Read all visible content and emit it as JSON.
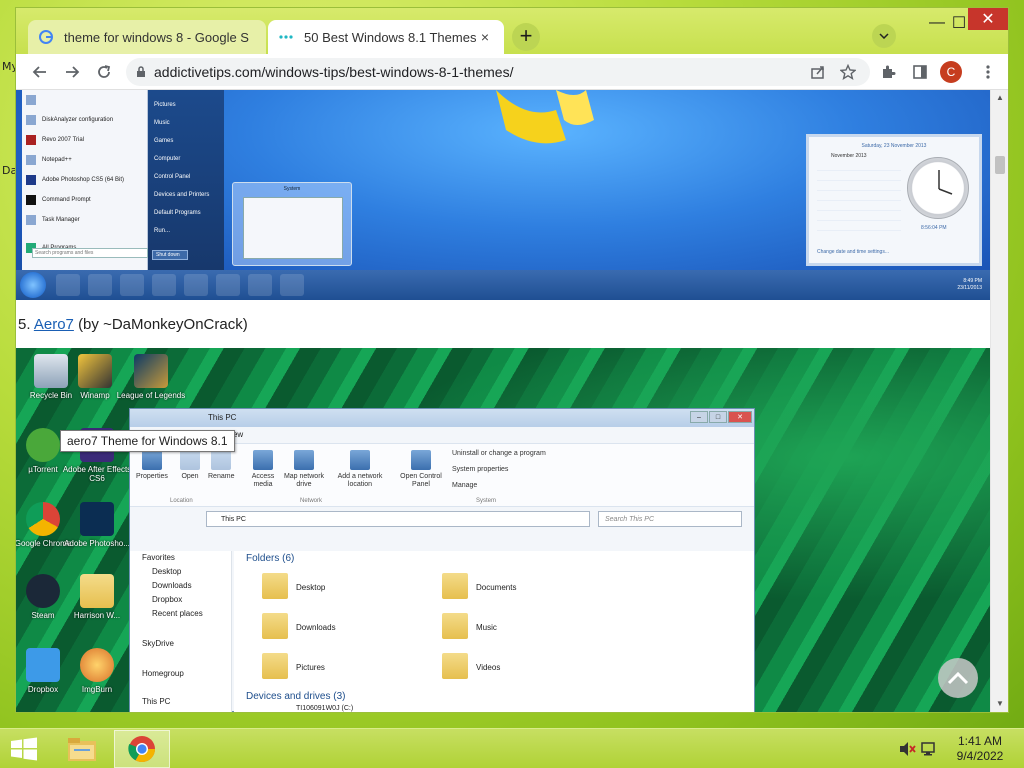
{
  "desktop_fragments": [
    "My",
    "Da"
  ],
  "browser": {
    "tabs": [
      {
        "title": "theme for windows 8 - Google S",
        "active": false
      },
      {
        "title": "50 Best Windows 8.1 Themes",
        "active": true
      }
    ],
    "new_tab_symbol": "+",
    "tab_close_symbol": "×",
    "address": "addictivetips.com/windows-tips/best-windows-8-1-themes/",
    "profile_initial": "C",
    "window_min": "—",
    "window_max": "☐",
    "window_close": "✕"
  },
  "article": {
    "screenshot1": {
      "start_menu_items": [
        "",
        "DiskAnalyzer configuration",
        "Revo 2007 Trial",
        "Notepad++",
        "Adobe Photoshop CS5 (64 Bit)",
        "Command Prompt",
        "Task Manager",
        "All Programs"
      ],
      "start_menu_right": [
        "Pictures",
        "Music",
        "Games",
        "Computer",
        "Control Panel",
        "Devices and Printers",
        "Default Programs",
        "Run..."
      ],
      "search_placeholder": "Search programs and files",
      "shutdown_label": "Shut down",
      "thumbnail_title": "System",
      "gadget_date": "Saturday, 23 November 2013",
      "gadget_month": "November 2013",
      "gadget_time": "8:56:04 PM",
      "gadget_link": "Change date and time settings...",
      "taskbar_time": "8:49 PM",
      "taskbar_date": "23/11/2013"
    },
    "caption": {
      "number": "5.",
      "link_text": "Aero7",
      "author": "(by ~DaMonkeyOnCrack)"
    },
    "screenshot2": {
      "desktop_icons": [
        "Recycle Bin",
        "Winamp",
        "League of Legends",
        "µTorrent",
        "Adobe After Effects CS6",
        "Google Chrome",
        "Adobe Photosho...",
        "Steam",
        "Harrison W...",
        "Dropbox",
        "ImgBurn"
      ],
      "explorer_title": "This PC",
      "explorer_menu": "View",
      "ribbon_buttons": [
        "Properties",
        "Open",
        "Rename",
        "Access media",
        "Map network drive",
        "Add a network location",
        "Open Control Panel"
      ],
      "ribbon_small": [
        "Uninstall or change a program",
        "System properties",
        "Manage"
      ],
      "ribbon_groups": [
        "Location",
        "Network",
        "System"
      ],
      "address": "This PC",
      "search_placeholder": "Search This PC",
      "nav_items": [
        "Favorites",
        "Desktop",
        "Downloads",
        "Dropbox",
        "Recent places",
        "SkyDrive",
        "Homegroup",
        "This PC"
      ],
      "folders_header": "Folders (6)",
      "folders": [
        "Desktop",
        "Documents",
        "Downloads",
        "Music",
        "Pictures",
        "Videos"
      ],
      "devices_header": "Devices and drives (3)",
      "drive_label": "TI106091W0J (C:)",
      "tooltip": "aero7 Theme for Windows 8.1"
    }
  },
  "taskbar": {
    "time": "1:41 AM",
    "date": "9/4/2022"
  }
}
